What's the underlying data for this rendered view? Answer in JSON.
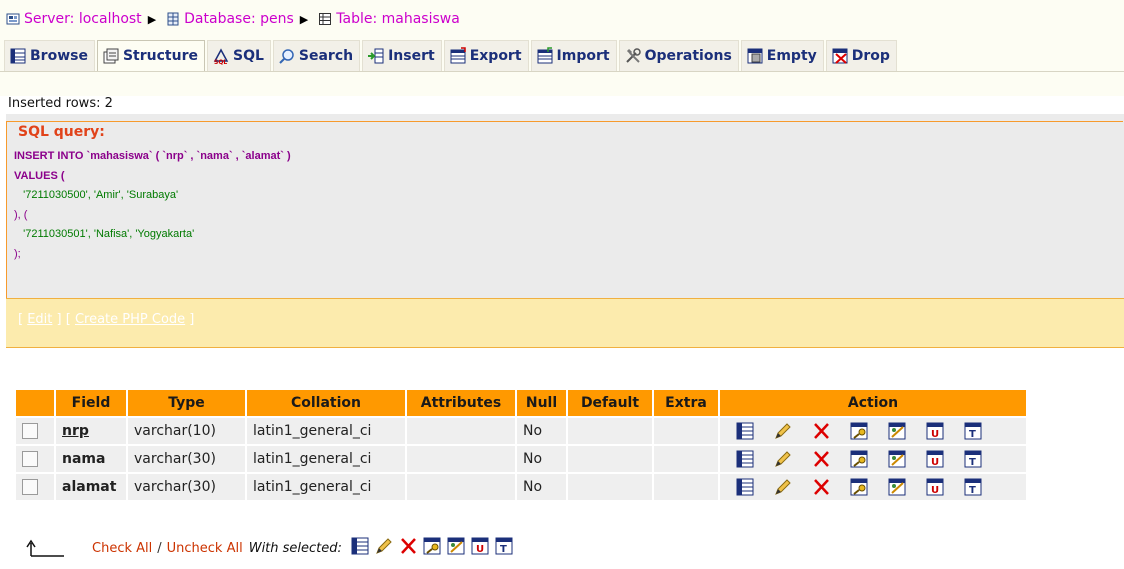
{
  "breadcrumb": [
    {
      "label": "Server: localhost",
      "icon": "server-icon"
    },
    {
      "label": "Database: pens",
      "icon": "database-icon"
    },
    {
      "label": "Table: mahasiswa",
      "icon": "table-icon"
    }
  ],
  "tabs": [
    {
      "label": "Browse",
      "icon": "browse-icon"
    },
    {
      "label": "Structure",
      "icon": "structure-icon",
      "active": true
    },
    {
      "label": "SQL",
      "icon": "sql-icon"
    },
    {
      "label": "Search",
      "icon": "search-icon"
    },
    {
      "label": "Insert",
      "icon": "insert-icon"
    },
    {
      "label": "Export",
      "icon": "export-icon"
    },
    {
      "label": "Import",
      "icon": "import-icon"
    },
    {
      "label": "Operations",
      "icon": "operations-icon"
    },
    {
      "label": "Empty",
      "icon": "empty-icon"
    },
    {
      "label": "Drop",
      "icon": "drop-icon"
    }
  ],
  "message": "Inserted rows: 2",
  "sql": {
    "legend": "SQL query:",
    "lines": [
      "INSERT INTO `mahasiswa` ( `nrp` , `nama` , `alamat` )",
      "VALUES (",
      "'7211030500', 'Amir', 'Surabaya'",
      "), (",
      "'7211030501', 'Nafisa', 'Yogyakarta'",
      ");"
    ],
    "edit_link": "Edit",
    "php_link": "Create PHP Code"
  },
  "table": {
    "headers": [
      "Field",
      "Type",
      "Collation",
      "Attributes",
      "Null",
      "Default",
      "Extra",
      "Action"
    ],
    "rows": [
      {
        "field": "nrp",
        "type": "varchar(10)",
        "collation": "latin1_general_ci",
        "attributes": "",
        "null": "No",
        "default": "",
        "extra": "",
        "primary": true
      },
      {
        "field": "nama",
        "type": "varchar(30)",
        "collation": "latin1_general_ci",
        "attributes": "",
        "null": "No",
        "default": "",
        "extra": "",
        "primary": false
      },
      {
        "field": "alamat",
        "type": "varchar(30)",
        "collation": "latin1_general_ci",
        "attributes": "",
        "null": "No",
        "default": "",
        "extra": "",
        "primary": false
      }
    ],
    "row_actions": [
      "browse-icon",
      "edit-icon",
      "delete-icon",
      "primary-key-icon",
      "index-icon",
      "unique-icon",
      "fulltext-icon"
    ]
  },
  "footer": {
    "check_all": "Check All",
    "separator": "/",
    "uncheck_all": "Uncheck All",
    "with_selected": "With selected:"
  },
  "colors": {
    "header_orange": "#ff9900",
    "row_gray": "#efefef",
    "sql_bg": "#ebebeb",
    "sql_footer": "#fcebad",
    "link_magenta": "#cc00cc",
    "tab_text": "#1b2f7a"
  }
}
